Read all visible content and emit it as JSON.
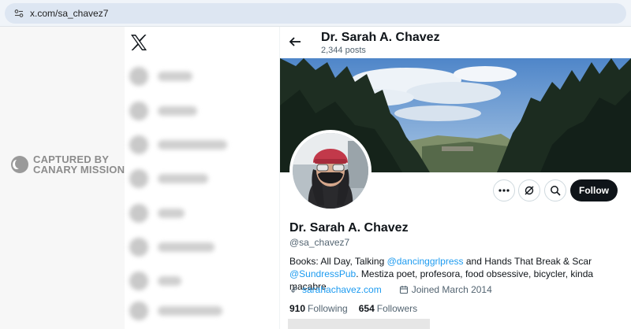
{
  "browser": {
    "url": "x.com/sa_chavez7"
  },
  "watermark": {
    "line1": "CAPTURED BY",
    "line2": "CANARY MISSION"
  },
  "header": {
    "name": "Dr. Sarah A. Chavez",
    "posts": "2,344 posts"
  },
  "profile": {
    "name": "Dr. Sarah A. Chavez",
    "handle": "@sa_chavez7",
    "bio_1": "Books: All Day, Talking ",
    "mention_1": "@dancinggrlpress",
    "bio_2": " and Hands That Break & Scar ",
    "mention_2": "@SundressPub",
    "bio_3": ". Mestiza poet, profesora, food obsessive, bicycler, kinda macabre",
    "website": "sarahachavez.com",
    "joined": "Joined March 2014",
    "following_count": "910",
    "following_label": "Following",
    "followers_count": "654",
    "followers_label": "Followers"
  },
  "actions": {
    "follow": "Follow"
  },
  "colors": {
    "accent": "#1d9bf0",
    "text": "#0f1419",
    "muted": "#536471"
  }
}
